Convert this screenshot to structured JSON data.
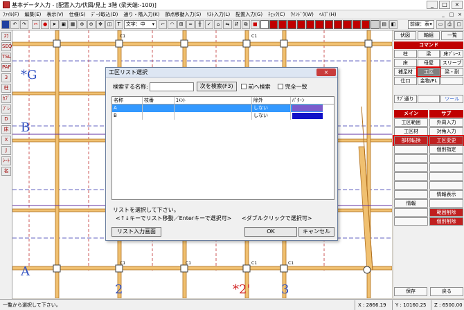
{
  "window": {
    "title": "基本データ入力 - [配置入力/伏図/見上 3階 (梁天端:-100)]",
    "controls": [
      "_",
      "□",
      "×"
    ]
  },
  "menu": {
    "items": [
      "ﾌｧｲﾙ(F)",
      "編集(E)",
      "表示(V)",
      "仕様(S)",
      "ﾃﾞｰﾀ取込(D)",
      "通り・階入力(K)",
      "節点移動入力(S)",
      "ﾘｽﾄ入力(L)",
      "配置入力(G)",
      "ﾁｪｯｸ(C)",
      "ｳｲﾝﾄﾞｳ(W)",
      "ﾍﾙﾌﾟ(H)"
    ],
    "mdi_controls": [
      "_",
      "□",
      "×"
    ]
  },
  "toolbar": {
    "font_combo": "文字：中",
    "right_combo": "前線：表"
  },
  "left_tools": [
    "ｽﾗ",
    "SEQ",
    "TSL",
    "PAF",
    "3",
    "柱",
    "ｶﾌﾞ",
    "ﾌﾞﾚ",
    "D",
    "床",
    "X",
    "J",
    "ｼｰﾄ",
    "名"
  ],
  "canvas": {
    "grid_labels": {
      "g": "*G",
      "b": "B",
      "a": "A",
      "x2": "2",
      "x2p": "*2'",
      "x3": "3"
    },
    "member_labels": [
      "C1",
      "C1",
      "C1",
      "C1",
      "C1",
      "C1"
    ]
  },
  "right_panel": {
    "top_buttons": [
      "伏図",
      "軸組",
      "一覧"
    ],
    "command_header": "コマンド",
    "command_grid": [
      "柱",
      "梁",
      "床ﾌﾞﾚｰｽ",
      "床",
      "母屋",
      "スリーブ",
      "補足材",
      "工区",
      "梁・耐",
      "仕口",
      "金物/PL",
      ""
    ],
    "selected_command": "工区",
    "tool_button": "ツール",
    "thru_button": "ｻﾌﾞ通り",
    "main_header": "メイン",
    "sub_header": "サブ",
    "main_buttons": [
      "工区範囲",
      "工区材",
      "部材転換",
      "",
      "",
      "",
      "",
      "",
      "",
      "情報",
      "",
      ""
    ],
    "sub_buttons": [
      "外周入力",
      "対角入力",
      "工区変更",
      "個別指定",
      "",
      "",
      "",
      "",
      "情報表示",
      "",
      "範囲削除",
      "個別削除"
    ],
    "bottom_buttons": [
      "保存",
      "戻る"
    ]
  },
  "status": {
    "message": "一覧から選択して下さい。",
    "x_label": "X : 2866.19",
    "y_label": "Y : 10160.25",
    "z_label": "Z : 6500.00"
  },
  "dialog": {
    "title": "工区リスト選択",
    "close_label": "×",
    "search_label": "検索する名称:",
    "search_value": "",
    "next_search_button": "次を検索(F3)",
    "prev_search_label": "前へ検索",
    "exact_match_label": "完全一致",
    "columns": [
      "名称",
      "枝番",
      "ｺﾒﾝﾄ",
      "除外",
      "ﾊﾟﾀｰﾝ"
    ],
    "rows": [
      {
        "name": "A",
        "branch": "",
        "comment": "",
        "exclude": "しない",
        "pattern_color": "#7b5ccc"
      },
      {
        "name": "B",
        "branch": "",
        "comment": "",
        "exclude": "しない",
        "pattern_color": "#1010c8"
      }
    ],
    "hint1": "リストを選択して下さい。",
    "hint2": "<↑↓キーでリスト移動／Enterキーで選択可>",
    "hint3": "<ダブルクリックで選択可>",
    "list_input_button": "リスト入力画面",
    "ok_button": "OK",
    "cancel_button": "キャンセル"
  },
  "colors": {
    "accent_red": "#c00000",
    "selection_blue": "#3399ff",
    "beam_orange": "#e8a040",
    "grid_blue": "#3050c0"
  }
}
